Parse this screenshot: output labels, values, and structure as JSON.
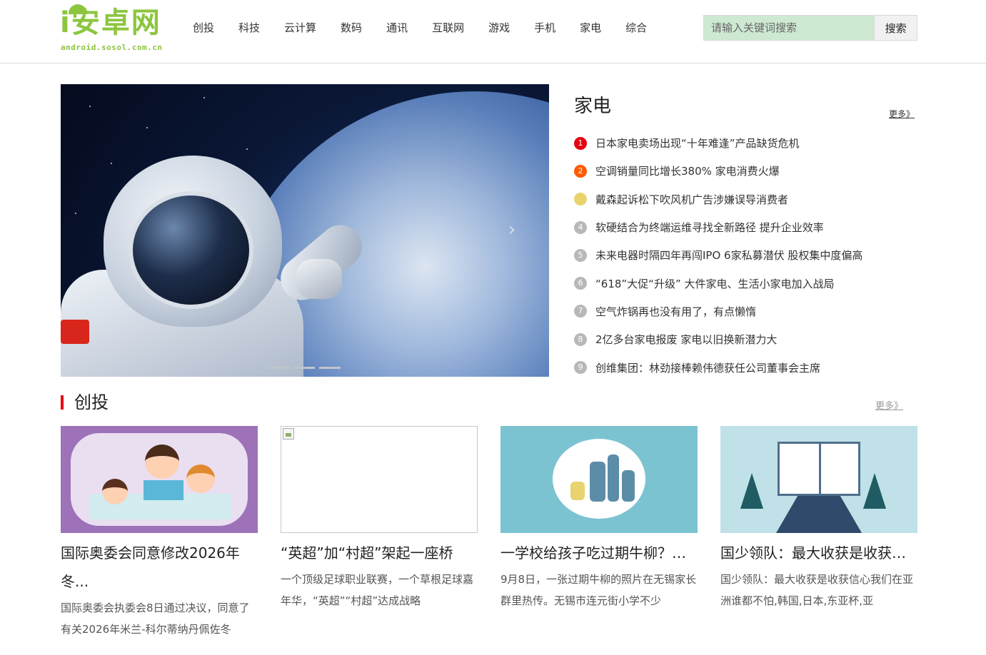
{
  "header": {
    "logo_text": "i安卓网",
    "logo_domain": "android.sosol.com.cn",
    "nav": [
      "创投",
      "科技",
      "云计算",
      "数码",
      "通讯",
      "互联网",
      "游戏",
      "手机",
      "家电",
      "综合"
    ],
    "search": {
      "placeholder": "请输入关键词搜索",
      "button": "搜索"
    }
  },
  "banner": {
    "next_glyph": "›"
  },
  "side": {
    "title": "家电",
    "more": "更多》",
    "items": [
      "日本家电卖场出现“十年难逢”产品缺货危机",
      "空调销量同比增长380% 家电消费火爆",
      "戴森起诉松下吹风机广告涉嫌误导消费者",
      "软硬结合为终端运维寻找全新路径 提升企业效率",
      "未来电器时隔四年再闯IPO 6家私募潜伏 股权集中度偏高",
      "“618”大促“升级” 大件家电、生活小家电加入战局",
      "空气炸锅再也没有用了，有点懒惰",
      "2亿多台家电报废 家电以旧换新潜力大",
      "创维集团：林劲接棒赖伟德获任公司董事会主席"
    ],
    "ranks": [
      "1",
      "2",
      "",
      "4",
      "5",
      "6",
      "7",
      "8",
      "9"
    ]
  },
  "section": {
    "title": "创投",
    "more": "更多》",
    "cards": [
      {
        "title": "国际奥委会同意修改2026年冬...",
        "desc": "国际奥委会执委会8日通过决议，同意了有关2026年米兰-科尔蒂纳丹佩佐冬"
      },
      {
        "title": "“英超”加“村超”架起一座桥",
        "desc": "一个顶级足球职业联赛，一个草根足球嘉年华，“英超”“村超”达成战略"
      },
      {
        "title": "一学校给孩子吃过期牛柳？官...",
        "desc": "9月8日，一张过期牛柳的照片在无锡家长群里热传。无锡市连元街小学不少"
      },
      {
        "title": "国少领队：最大收获是收获信...",
        "desc": "国少领队：最大收获是收获信心我们在亚洲谁都不怕,韩国,日本,东亚杯,亚"
      }
    ]
  }
}
